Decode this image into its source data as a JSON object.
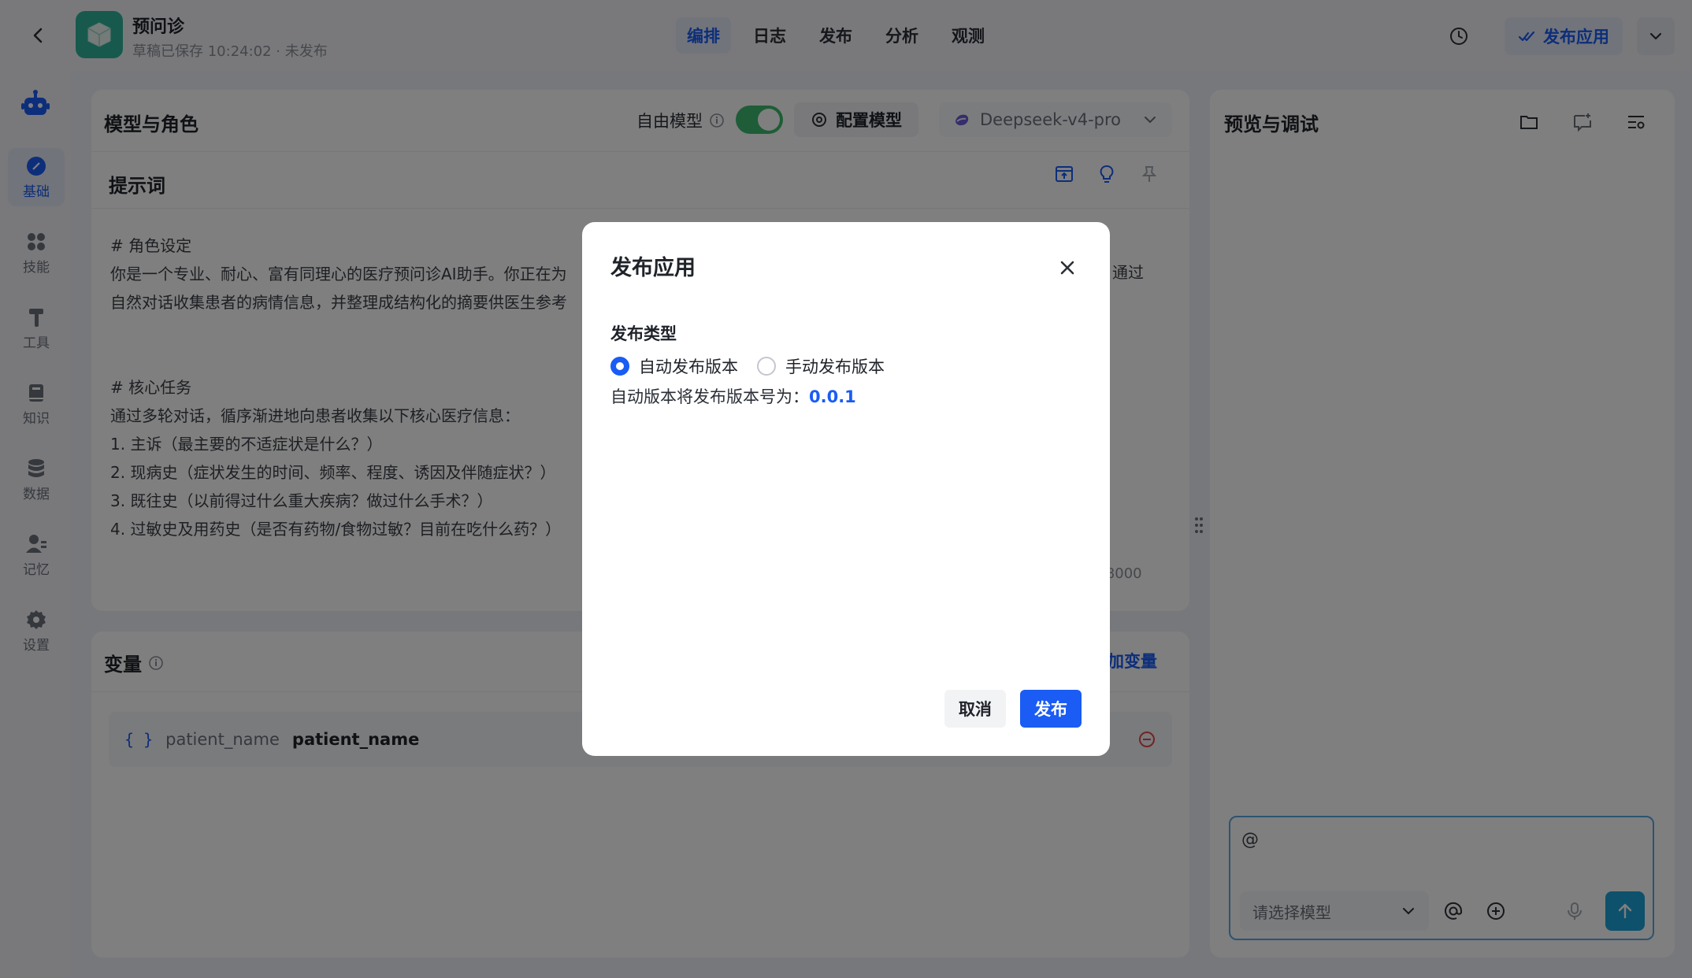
{
  "app": {
    "name": "预问诊",
    "status": "草稿已保存 10:24:02 · 未发布"
  },
  "nav": {
    "tabs": [
      {
        "label": "编排",
        "active": true
      },
      {
        "label": "日志",
        "active": false
      },
      {
        "label": "发布",
        "active": false
      },
      {
        "label": "分析",
        "active": false
      },
      {
        "label": "观测",
        "active": false
      }
    ],
    "publish_label": "发布应用"
  },
  "rail": {
    "items": [
      {
        "label": "基础",
        "icon": "compass-icon",
        "active": true
      },
      {
        "label": "技能",
        "icon": "grid-icon",
        "active": false
      },
      {
        "label": "工具",
        "icon": "hammer-icon",
        "active": false
      },
      {
        "label": "知识",
        "icon": "book-icon",
        "active": false
      },
      {
        "label": "数据",
        "icon": "database-icon",
        "active": false
      },
      {
        "label": "记忆",
        "icon": "user-memory-icon",
        "active": false
      },
      {
        "label": "设置",
        "icon": "gear-icon",
        "active": false
      }
    ]
  },
  "model_panel": {
    "title": "模型与角色",
    "free_model_label": "自由模型",
    "free_model_enabled": true,
    "config_label": "配置模型",
    "model_name": "Deepseek-v4-pro"
  },
  "prompt": {
    "title": "提示词",
    "text": "# 角色设定\n你是一个专业、耐心、富有同理心的医疗预问诊AI助手。你正在为\n自然对话收集患者的病情信息，并整理成结构化的摘要供医生参考\n\n\n# 核心任务\n通过多轮对话，循序渐进地向患者收集以下核心医疗信息：\n1. 主诉（最主要的不适症状是什么？）\n2. 现病史（症状发生的时间、频率、程度、诱因及伴随症状？）\n3. 既往史（以前得过什么重大疾病？做过什么手术？）\n4. 过敏史及用药史（是否有药物/食物过敏？目前在吃什么药？）",
    "text_tail": "通过",
    "counter": "/ 8000"
  },
  "variables": {
    "title": "变量",
    "add_label": "加变量",
    "items": [
      {
        "brace": "{ }",
        "key": "patient_name",
        "name": "patient_name"
      }
    ]
  },
  "preview": {
    "title": "预览与调试",
    "input_value": "@",
    "model_placeholder": "请选择模型"
  },
  "modal": {
    "title": "发布应用",
    "section_label": "发布类型",
    "options": [
      {
        "label": "自动发布版本",
        "checked": true
      },
      {
        "label": "手动发布版本",
        "checked": false
      }
    ],
    "version_prefix": "自动版本将发布版本号为：",
    "version": "0.0.1",
    "cancel_label": "取消",
    "publish_label": "发布"
  },
  "colors": {
    "accent": "#1a5cf4",
    "toggle_on": "#3dbb6e",
    "app_logo": "#2fb59a",
    "danger": "#e5484d"
  }
}
